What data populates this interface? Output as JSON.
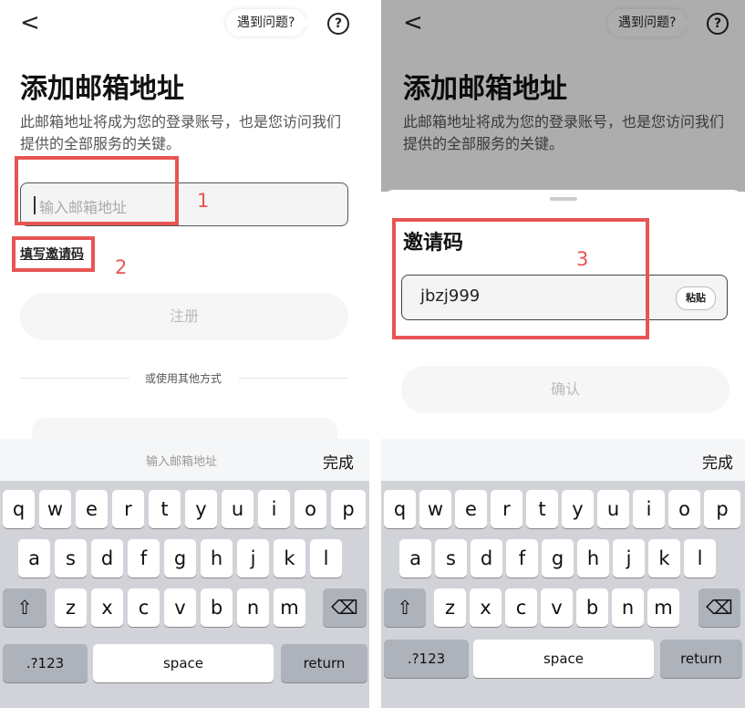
{
  "left": {
    "back": "<",
    "help_bubble": "遇到问题?",
    "help_icon": "?",
    "title": "添加邮箱地址",
    "subtitle": "此邮箱地址将成为您的登录账号，也是您访问我们提供的全部服务的关键。",
    "email_placeholder": "输入邮箱地址",
    "invite_link": "填写邀请码",
    "register_button": "注册",
    "divider_text": "或使用其他方式",
    "annotations": [
      "1",
      "2"
    ],
    "keyboard_bar_placeholder": "输入邮箱地址",
    "keyboard_done": "完成"
  },
  "right": {
    "back": "<",
    "help_bubble": "遇到问题?",
    "help_icon": "?",
    "title": "添加邮箱地址",
    "subtitle": "此邮箱地址将成为您的登录账号，也是您访问我们提供的全部服务的关键。",
    "sheet_title": "邀请码",
    "invite_code_value": "jbzj999",
    "paste_button": "粘贴",
    "confirm_button": "确认",
    "annotation": "3",
    "keyboard_done": "完成"
  },
  "keyboard": {
    "row1": [
      "q",
      "w",
      "e",
      "r",
      "t",
      "y",
      "u",
      "i",
      "o",
      "p"
    ],
    "row2": [
      "a",
      "s",
      "d",
      "f",
      "g",
      "h",
      "j",
      "k",
      "l"
    ],
    "row3": [
      "z",
      "x",
      "c",
      "v",
      "b",
      "n",
      "m"
    ],
    "shift_icon": "⇧",
    "delete_icon": "⌫",
    "numbers": ".?123",
    "space": "space",
    "return": "return"
  },
  "colors": {
    "annotation": "#e85454",
    "keyboard_bg": "#d1d3d9"
  }
}
